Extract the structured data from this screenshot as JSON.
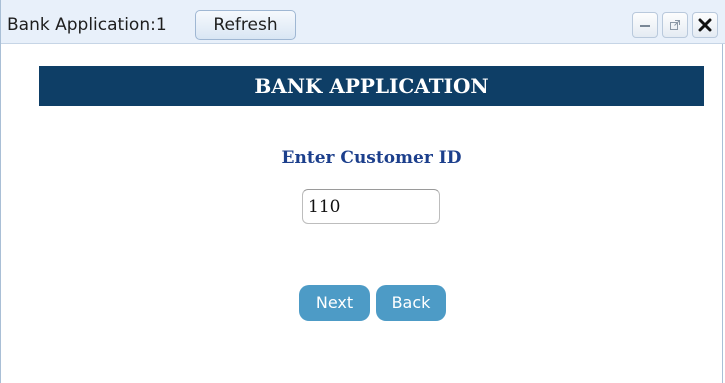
{
  "window": {
    "title": "Bank Application:1",
    "refresh_label": "Refresh",
    "controls": {
      "minimize_icon": "minimize-icon",
      "popout_icon": "popout-icon",
      "close_icon": "close-icon"
    }
  },
  "header": {
    "banner": "BANK APPLICATION"
  },
  "form": {
    "label": "Enter Customer ID",
    "customer_id_value": "110"
  },
  "actions": {
    "next_label": "Next",
    "back_label": "Back"
  },
  "colors": {
    "banner_bg": "#0e3e66",
    "label_text": "#1c3f8c",
    "button_bg": "#4d9bc6"
  }
}
